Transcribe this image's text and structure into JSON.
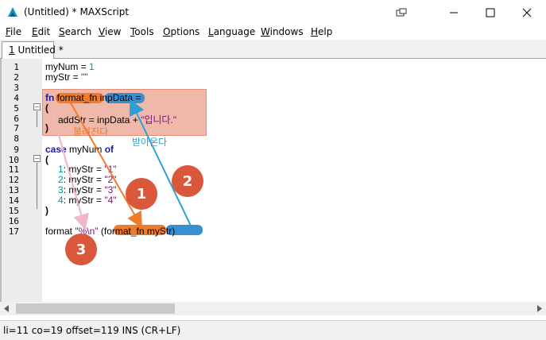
{
  "window": {
    "title": "(Untitled) * MAXScript"
  },
  "menu": {
    "items": [
      {
        "u": "F",
        "rest": "ile"
      },
      {
        "u": "E",
        "rest": "dit"
      },
      {
        "u": "S",
        "rest": "earch"
      },
      {
        "u": "V",
        "rest": "iew"
      },
      {
        "u": "T",
        "rest": "ools"
      },
      {
        "u": "O",
        "rest": "ptions"
      },
      {
        "u": "L",
        "rest": "anguage"
      },
      {
        "u": "W",
        "rest": "indows"
      },
      {
        "u": "H",
        "rest": "elp"
      }
    ]
  },
  "tab": {
    "num": "1",
    "label": " Untitled *"
  },
  "code": {
    "l1a": "myNum = ",
    "l1b": "1",
    "l2a": "myStr = ",
    "l2b": "\"\"",
    "l4kw": "fn",
    "l4a": " format_fn inpData =",
    "l5": "(",
    "l6a": "addStr = inpData + ",
    "l6b": "\"입니다.\"",
    "l7": ")",
    "l9kw1": "case",
    "l9a": " myNum ",
    "l9kw2": "of",
    "l10": "(",
    "l11a": "1",
    "l11b": ": myStr = ",
    "l11c": "\"1\"",
    "l12a": "2",
    "l12b": ": myStr = ",
    "l12c": "\"2\"",
    "l13a": "3",
    "l13b": ": myStr = ",
    "l13c": "\"3\"",
    "l14a": "4",
    "l14b": ": myStr = ",
    "l14c": "\"4\"",
    "l15": ")",
    "l17a": "format ",
    "l17b": "\"%\\n\"",
    "l17c": " (format_fn myStr)"
  },
  "line_numbers": [
    "1",
    "2",
    "3",
    "4",
    "5",
    "6",
    "7",
    "8",
    "9",
    "10",
    "11",
    "12",
    "13",
    "14",
    "15",
    "16",
    "17"
  ],
  "annotations": {
    "badge1": "1",
    "badge2": "2",
    "badge3": "3",
    "called": "불려진다",
    "received": "받아온다"
  },
  "status": {
    "text": "li=11 co=19 offset=119 INS (CR+LF)"
  },
  "colors": {
    "badge": "#d9573b",
    "highlight_box": "#f0b8a8",
    "orange_marker": "#f07b2a",
    "blue_marker": "#3a8fd0",
    "pink_arrow": "#f2b6c6",
    "keyword": "#1a1aa6",
    "number": "#009999",
    "string": "#7a0f7a"
  },
  "icons": [
    "maxscript-app-icon",
    "restore-window-icon",
    "minimize-icon",
    "maximize-icon",
    "close-icon"
  ]
}
